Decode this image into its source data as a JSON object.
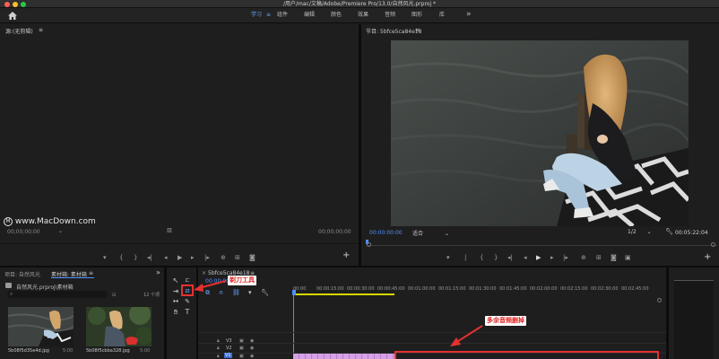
{
  "window": {
    "title": "/用户/mac/文稿/Adobe/Premiere Pro/13.0/自然风光.prproj *"
  },
  "workspaces": {
    "tabs": [
      "学习",
      "组件",
      "编辑",
      "颜色",
      "效果",
      "音频",
      "图形",
      "库"
    ],
    "active": "学习",
    "more": "»"
  },
  "source_monitor": {
    "title": "源:(无剪辑)",
    "menu": "≡",
    "timecode_left": "00;00;00;00",
    "timecode_right": "00;00;00;00",
    "add": "+"
  },
  "program_monitor": {
    "title": "节目: 5bfce5ca84e18",
    "menu": "≡",
    "timecode": "00:00:00:00",
    "fit": "适合",
    "fraction": "1/2",
    "duration": "00:05:22:04",
    "add": "+"
  },
  "watermark": {
    "text": "www.MacDown.com"
  },
  "project": {
    "tab1": "项目: 自然风光",
    "tab2": "素材箱: 素材箱",
    "menu": "≡",
    "more": "»",
    "path": "自然风光.prproj\\素材箱",
    "item_count": "12 个项",
    "items": [
      {
        "name": "5b08f5d35e4d.jpg",
        "duration": "5:00"
      },
      {
        "name": "5b08f5cbba328.jpg",
        "duration": "5:00"
      }
    ]
  },
  "timeline": {
    "sequence_name": "5bfce5ca84e18",
    "menu": "≡",
    "timecode": "00:00:00:00",
    "ruler": [
      "00:00",
      "00:00:15:00",
      "00:00:30:00",
      "00:00:45:00",
      "00:01:00:00",
      "00:01:15:00",
      "00:01:30:00",
      "00:01:45:00",
      "00:02:00:00",
      "00:02:15:00",
      "00:02:30:00",
      "00:02:45:00"
    ],
    "tracks": [
      "V3",
      "V2",
      "V1"
    ]
  },
  "annotations": {
    "razor_tool": "剃刀工具",
    "delete_audio": "多余音频删掉"
  },
  "colors": {
    "accent_blue": "#4d8fff",
    "annotation_red": "#e53030",
    "clip_pink": "#d6a0e8",
    "work_area_yellow": "#d8d800"
  }
}
